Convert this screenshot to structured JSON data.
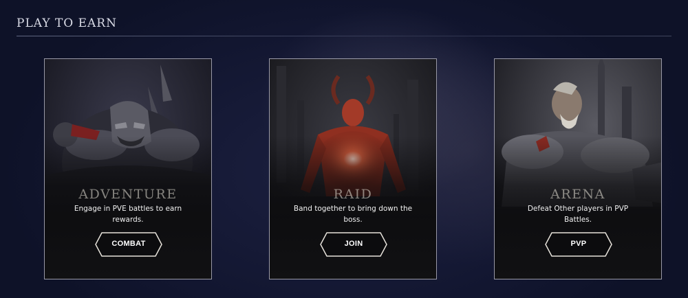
{
  "section": {
    "title": "PLAY TO EARN"
  },
  "cards": [
    {
      "title": "ADVENTURE",
      "description": "Engage in PVE battles to earn rewards.",
      "button": "COMBAT"
    },
    {
      "title": "RAID",
      "description": "Band together to bring down the boss.",
      "button": "JOIN"
    },
    {
      "title": "ARENA",
      "description": "Defeat Other players in PVP Battles.",
      "button": "PVP"
    }
  ],
  "colors": {
    "background": "#121630",
    "card_border": "#9a9aa8",
    "button_border": "#e8e4dc",
    "raid_accent": "#c0402a"
  }
}
